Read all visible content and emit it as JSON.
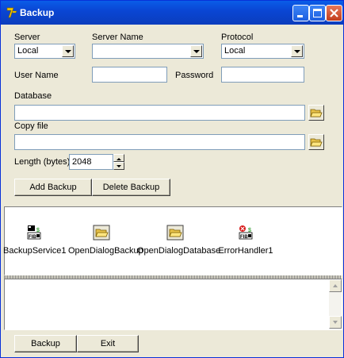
{
  "window": {
    "title": "Backup"
  },
  "labels": {
    "server": "Server",
    "server_name": "Server Name",
    "protocol": "Protocol",
    "user_name": "User Name",
    "password": "Password",
    "database": "Database",
    "copy_file": "Copy file",
    "length": "Length (bytes)"
  },
  "fields": {
    "server": "Local",
    "server_name": "",
    "protocol": "Local",
    "user_name": "",
    "password": "",
    "database": "",
    "copy_file": "",
    "length": "2048"
  },
  "buttons": {
    "add_backup": "Add Backup",
    "delete_backup": "Delete Backup",
    "backup": "Backup",
    "exit": "Exit"
  },
  "components": [
    {
      "label": "BackupService1",
      "icon": "backup-service-icon"
    },
    {
      "label": "OpenDialogBackup",
      "icon": "open-folder-icon"
    },
    {
      "label": "OpenDialogDatabase",
      "icon": "open-folder-icon"
    },
    {
      "label": "ErrorHandler1",
      "icon": "error-handler-icon"
    }
  ]
}
